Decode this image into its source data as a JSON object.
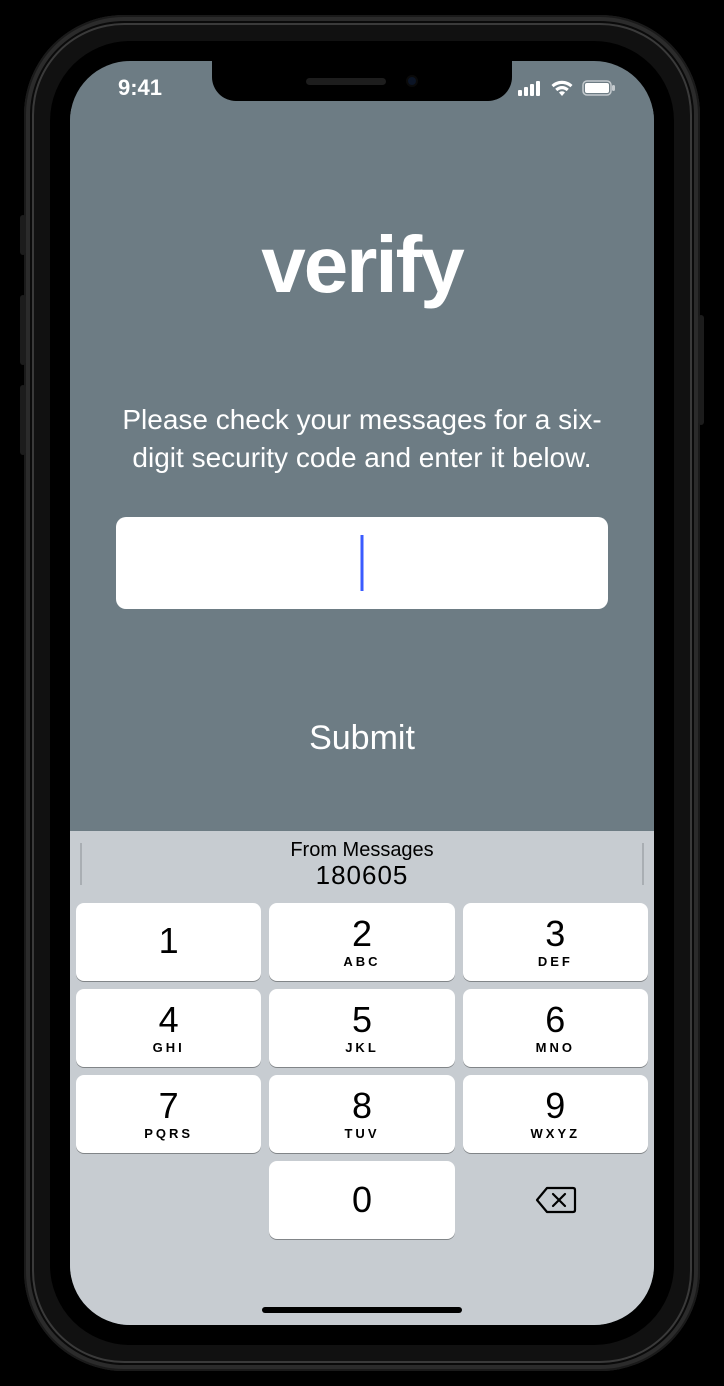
{
  "statusbar": {
    "time": "9:41"
  },
  "main": {
    "title": "verify",
    "instructions": "Please check your messages for a six-digit security code and enter it below.",
    "code_value": "",
    "submit_label": "Submit"
  },
  "keyboard": {
    "suggestion_source": "From Messages",
    "suggestion_value": "180605",
    "keys": [
      {
        "digit": "1",
        "letters": ""
      },
      {
        "digit": "2",
        "letters": "ABC"
      },
      {
        "digit": "3",
        "letters": "DEF"
      },
      {
        "digit": "4",
        "letters": "GHI"
      },
      {
        "digit": "5",
        "letters": "JKL"
      },
      {
        "digit": "6",
        "letters": "MNO"
      },
      {
        "digit": "7",
        "letters": "PQRS"
      },
      {
        "digit": "8",
        "letters": "TUV"
      },
      {
        "digit": "9",
        "letters": "WXYZ"
      },
      {
        "digit": "",
        "letters": ""
      },
      {
        "digit": "0",
        "letters": ""
      },
      {
        "digit": "⌫",
        "letters": ""
      }
    ]
  },
  "colors": {
    "bg": "#6d7c84",
    "keyboard_bg": "#c7ccd1",
    "caret": "#3a5bff"
  }
}
